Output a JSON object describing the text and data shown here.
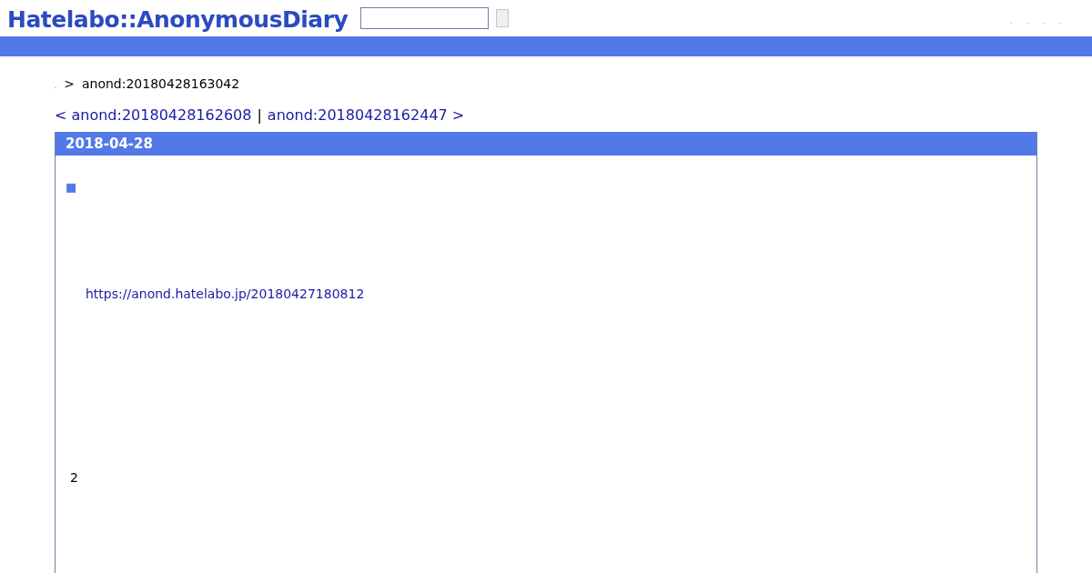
{
  "header": {
    "logo": "Hatelabo::AnonymousDiary",
    "nav": [
      ".",
      ".",
      ".",
      "."
    ]
  },
  "breadcrumb": {
    "home": ".",
    "separator": ">",
    "current": "anond:20180428163042"
  },
  "pager": {
    "prev": "< anond:20180428162608",
    "separator": "|",
    "next": "anond:20180428162447 >"
  },
  "day": {
    "date": "2018-04-28",
    "section_mark": "■",
    "link": "https://anond.hatelabo.jp/20180427180812",
    "body_text": "2"
  }
}
